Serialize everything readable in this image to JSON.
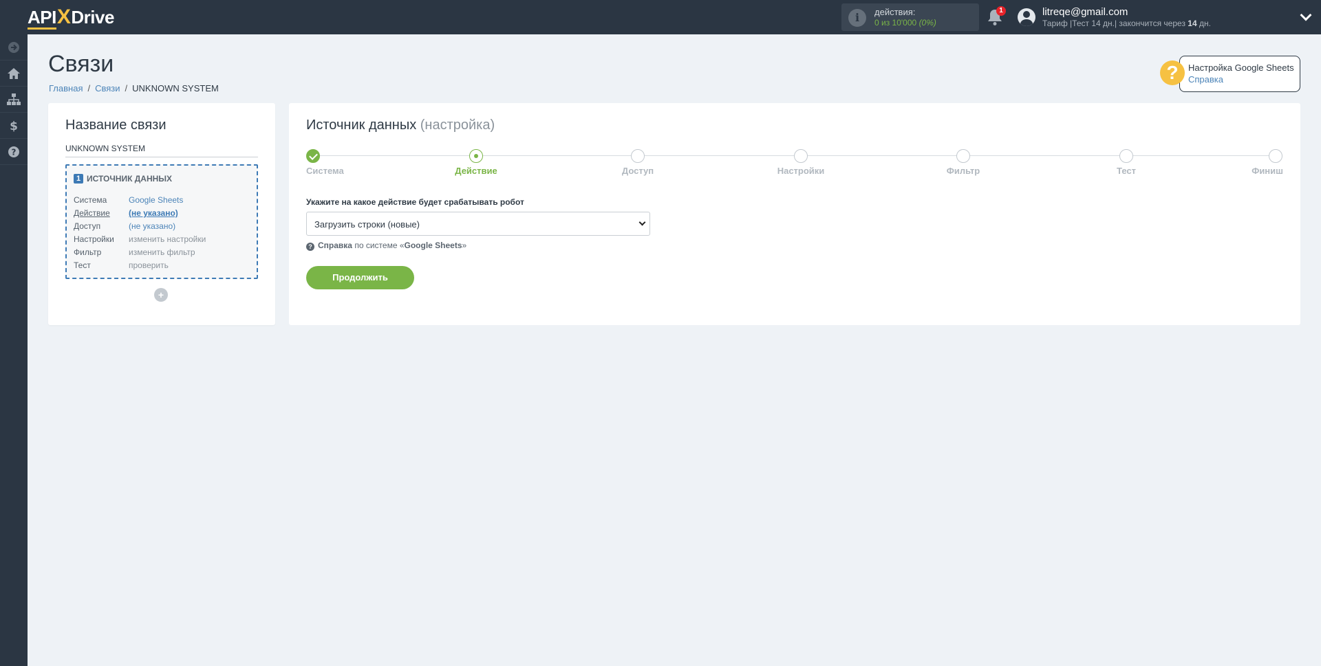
{
  "header": {
    "logo_left": "API",
    "logo_x": "X",
    "logo_right": "Drive",
    "actions_label": "действия:",
    "actions_used": "0 из 10'000",
    "actions_pct": "(0%)",
    "notifications_count": "1",
    "user_email": "litreqe@gmail.com",
    "plan_prefix": "Тариф |Тест 14 дн.| закончится через ",
    "plan_days": "14",
    "plan_suffix": " дн."
  },
  "sidebar": {
    "items": [
      {
        "icon": "arrow-right-icon"
      },
      {
        "icon": "home-icon"
      },
      {
        "icon": "sitemap-icon"
      },
      {
        "icon": "dollar-icon"
      },
      {
        "icon": "question-icon"
      }
    ]
  },
  "page": {
    "title": "Связи",
    "breadcrumb": [
      "Главная",
      "Связи",
      "UNKNOWN SYSTEM"
    ]
  },
  "help": {
    "title": "Настройка Google Sheets",
    "link": "Справка"
  },
  "left_card": {
    "heading": "Название связи",
    "connection_name": "UNKNOWN SYSTEM",
    "source": {
      "number": "1",
      "title": "ИСТОЧНИК ДАННЫХ",
      "rows": [
        {
          "key": "Система",
          "value": "Google Sheets"
        },
        {
          "key": "Действие",
          "value": "(не указано)"
        },
        {
          "key": "Доступ",
          "value": "(не указано)"
        },
        {
          "key": "Настройки",
          "value": "изменить настройки"
        },
        {
          "key": "Фильтр",
          "value": "изменить фильтр"
        },
        {
          "key": "Тест",
          "value": "проверить"
        }
      ]
    },
    "add_label": "+"
  },
  "right_card": {
    "heading": "Источник данных",
    "heading_sub": "(настройка)",
    "steps": [
      {
        "label": "Система",
        "state": "done"
      },
      {
        "label": "Действие",
        "state": "active"
      },
      {
        "label": "Доступ",
        "state": "todo"
      },
      {
        "label": "Настройки",
        "state": "todo"
      },
      {
        "label": "Фильтр",
        "state": "todo"
      },
      {
        "label": "Тест",
        "state": "todo"
      },
      {
        "label": "Финиш",
        "state": "todo"
      }
    ],
    "field_label": "Укажите на какое действие будет срабатывать робот",
    "select_value": "Загрузить строки (новые)",
    "hint_bold": "Справка",
    "hint_text": " по системе «",
    "hint_system": "Google Sheets",
    "hint_end": "»",
    "continue_label": "Продолжить"
  },
  "colors": {
    "topbar": "#2b3643",
    "accent_green": "#7ab547",
    "accent_yellow": "#f6c142",
    "link_blue": "#4c84b8",
    "badge_red": "#e8232a"
  }
}
